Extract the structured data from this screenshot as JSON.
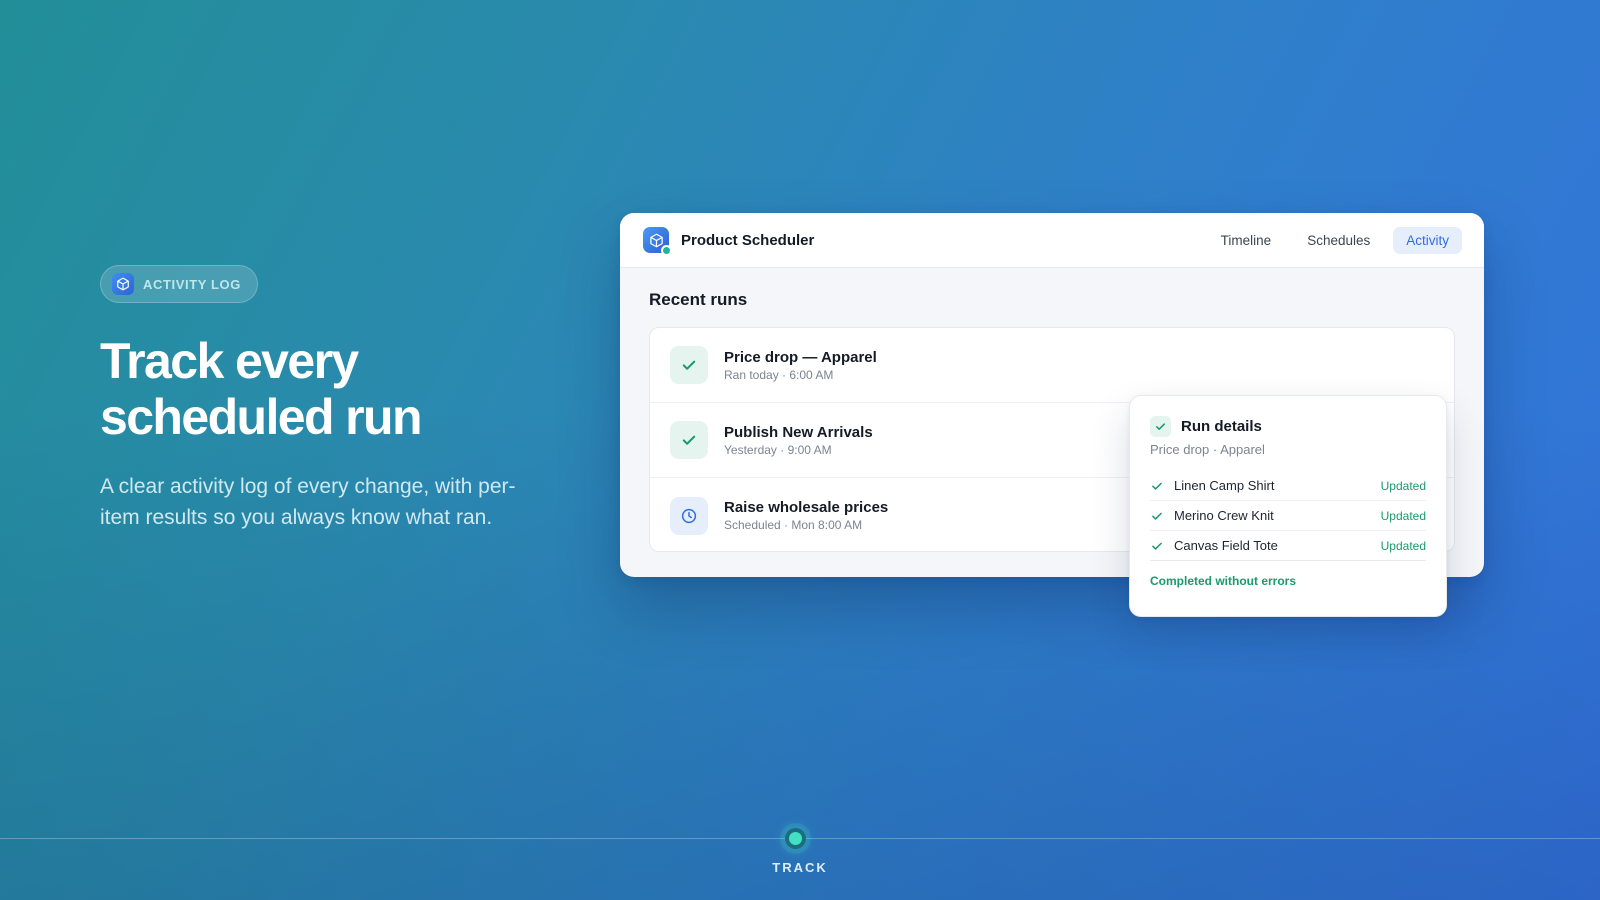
{
  "hero": {
    "badge_label": "ACTIVITY LOG",
    "title_line1": "Track every",
    "title_line2": "scheduled run",
    "subtitle": "A clear activity log of every change, with per-item results so you always know what ran."
  },
  "app": {
    "title": "Product Scheduler",
    "tabs": [
      {
        "label": "Timeline",
        "active": false
      },
      {
        "label": "Schedules",
        "active": false
      },
      {
        "label": "Activity",
        "active": true
      }
    ],
    "section_title": "Recent runs",
    "runs": [
      {
        "name": "Price drop — Apparel",
        "meta": "Ran today · 6:00 AM",
        "status_icon": "check-icon"
      },
      {
        "name": "Publish New Arrivals",
        "meta": "Yesterday · 9:00 AM",
        "status_icon": "check-icon"
      },
      {
        "name": "Raise wholesale prices",
        "meta": "Scheduled · Mon 8:00 AM",
        "status_icon": "clock-icon"
      }
    ],
    "details": {
      "title": "Run details",
      "subtitle": "Price drop · Apparel",
      "items": [
        {
          "name": "Linen Camp Shirt",
          "status": "Updated"
        },
        {
          "name": "Merino Crew Knit",
          "status": "Updated"
        },
        {
          "name": "Canvas Field Tote",
          "status": "Updated"
        }
      ],
      "footer": "Completed without errors"
    }
  },
  "track": {
    "label": "TRACK"
  },
  "colors": {
    "accent": "#2f6ee0",
    "success": "#1b9a6b",
    "track_dot": "#43e0c6"
  }
}
